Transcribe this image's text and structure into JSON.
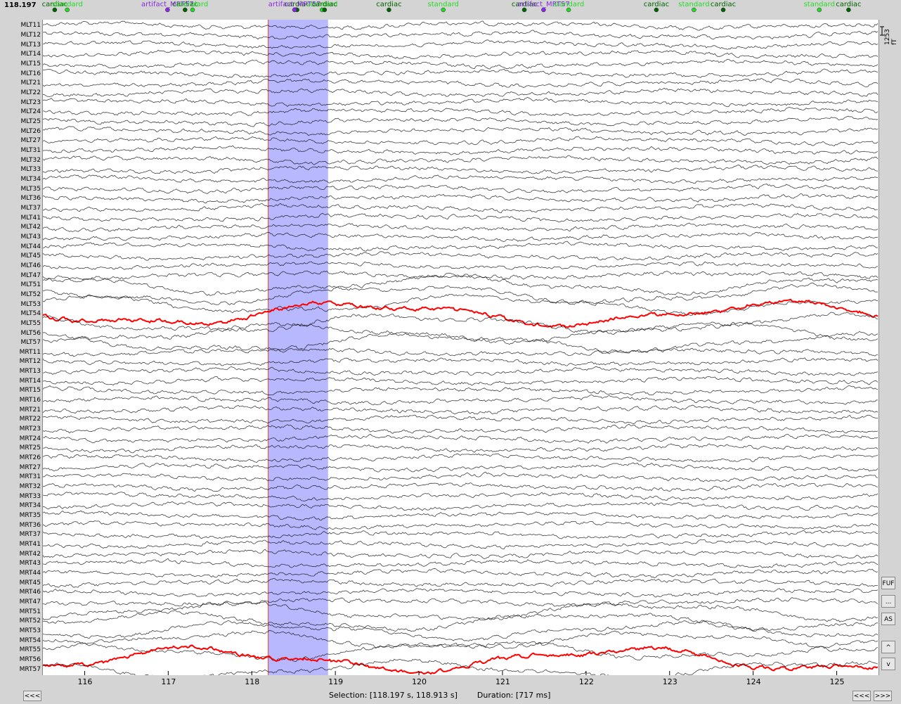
{
  "header": {
    "time": "118.197"
  },
  "time_axis": {
    "start": 115.5,
    "end": 125.5,
    "ticks": [
      "116",
      "117",
      "118",
      "119",
      "120",
      "121",
      "122",
      "123",
      "124",
      "125"
    ]
  },
  "selection": {
    "start": 118.197,
    "end": 118.913,
    "fill": "#b8b8ff",
    "border": "#ff3030"
  },
  "scale": {
    "label": "1253 fT"
  },
  "channels": [
    "MLT11",
    "MLT12",
    "MLT13",
    "MLT14",
    "MLT15",
    "MLT16",
    "MLT21",
    "MLT22",
    "MLT23",
    "MLT24",
    "MLT25",
    "MLT26",
    "MLT27",
    "MLT31",
    "MLT32",
    "MLT33",
    "MLT34",
    "MLT35",
    "MLT36",
    "MLT37",
    "MLT41",
    "MLT42",
    "MLT43",
    "MLT44",
    "MLT45",
    "MLT46",
    "MLT47",
    "MLT51",
    "MLT52",
    "MLT53",
    "MLT54",
    "MLT55",
    "MLT56",
    "MLT57",
    "MRT11",
    "MRT12",
    "MRT13",
    "MRT14",
    "MRT15",
    "MRT16",
    "MRT21",
    "MRT22",
    "MRT23",
    "MRT24",
    "MRT25",
    "MRT26",
    "MRT27",
    "MRT31",
    "MRT32",
    "MRT33",
    "MRT34",
    "MRT35",
    "MRT36",
    "MRT37",
    "MRT41",
    "MRT42",
    "MRT43",
    "MRT44",
    "MRT45",
    "MRT46",
    "MRT47",
    "MRT51",
    "MRT52",
    "MRT53",
    "MRT54",
    "MRT55",
    "MRT56",
    "MRT57"
  ],
  "highlighted_channels": [
    "MLT54",
    "MRT56"
  ],
  "colors": {
    "trace": "#000000",
    "highlight": "#ff0000",
    "cardiac": "#006400",
    "standard": "#22dd22",
    "artifact": "#8a2be2"
  },
  "events": [
    {
      "t": 115.65,
      "label": "cardiac",
      "type": "cardiac"
    },
    {
      "t": 115.8,
      "label": "standard",
      "type": "standard"
    },
    {
      "t": 117.0,
      "label": "artifact_MRT57",
      "type": "artifact"
    },
    {
      "t": 117.21,
      "label": "cardiac",
      "type": "cardiac"
    },
    {
      "t": 117.3,
      "label": "standard",
      "type": "standard"
    },
    {
      "t": 118.55,
      "label": "cardiac",
      "type": "cardiac"
    },
    {
      "t": 118.52,
      "label": "artifact_MRT57",
      "type": "artifact"
    },
    {
      "t": 118.85,
      "label": "standard",
      "type": "standard"
    },
    {
      "t": 118.88,
      "label": "cardiac",
      "type": "cardiac"
    },
    {
      "t": 119.65,
      "label": "cardiac",
      "type": "cardiac"
    },
    {
      "t": 120.3,
      "label": "standard",
      "type": "standard"
    },
    {
      "t": 121.27,
      "label": "cardiac",
      "type": "cardiac"
    },
    {
      "t": 121.5,
      "label": "artifact_MRT57",
      "type": "artifact"
    },
    {
      "t": 121.8,
      "label": "standard",
      "type": "standard"
    },
    {
      "t": 122.85,
      "label": "cardiac",
      "type": "cardiac"
    },
    {
      "t": 123.3,
      "label": "standard",
      "type": "standard"
    },
    {
      "t": 123.65,
      "label": "cardiac",
      "type": "cardiac"
    },
    {
      "t": 124.8,
      "label": "standard",
      "type": "standard"
    },
    {
      "t": 125.15,
      "label": "cardiac",
      "type": "cardiac"
    }
  ],
  "side_buttons": {
    "fullfit": "FUF",
    "more": "...",
    "autoscale": "AS",
    "up": "^",
    "down": "v"
  },
  "nav": {
    "prev": "<<<",
    "next_prev": "<<<",
    "next": ">>>"
  },
  "status": {
    "selection": "Selection: [118.197 s, 118.913 s]",
    "duration": "Duration: [717 ms]"
  }
}
